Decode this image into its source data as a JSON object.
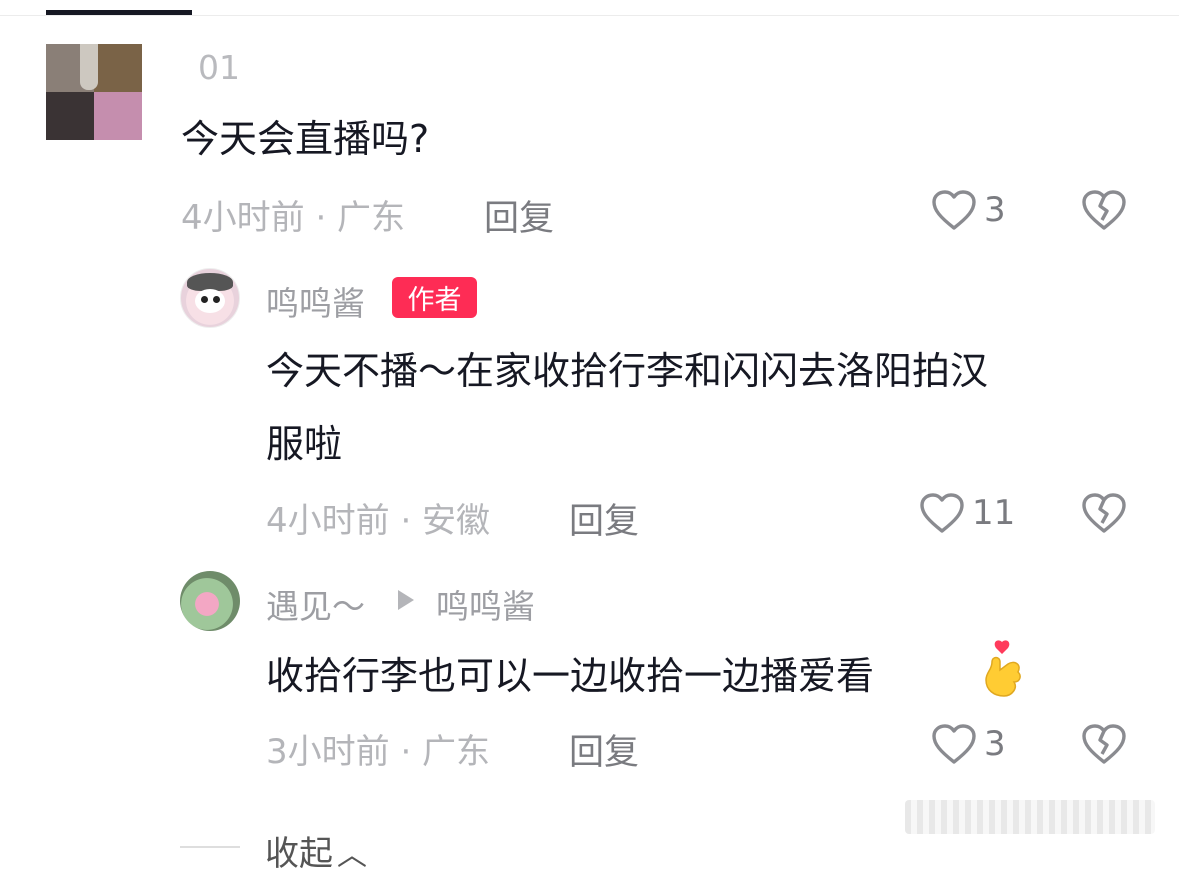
{
  "comments": [
    {
      "username": "",
      "username_partial": "​01",
      "text": "今天会直播吗?",
      "time_location": "4小时前 · 广东",
      "reply_label": "回复",
      "likes": "3"
    },
    {
      "username": "鸣鸣酱",
      "badge": "作者",
      "text_line1": "今天不播～在家收拾行李和闪闪去洛阳拍汉",
      "text_line2": "服啦",
      "time_location": "4小时前 · 安徽",
      "reply_label": "回复",
      "likes": "11"
    },
    {
      "username": "遇见～",
      "reply_to": "鸣鸣酱",
      "text": "收拾行李也可以一边收拾一边播爱看",
      "time_location": "3小时前 · 广东",
      "reply_label": "回复",
      "likes": "3"
    }
  ],
  "collapse_label": "收起",
  "icons": {
    "like": "heart-outline-icon",
    "dislike": "broken-heart-icon",
    "collapse": "chevron-up-icon",
    "emoji": "finger-heart-emoji"
  }
}
